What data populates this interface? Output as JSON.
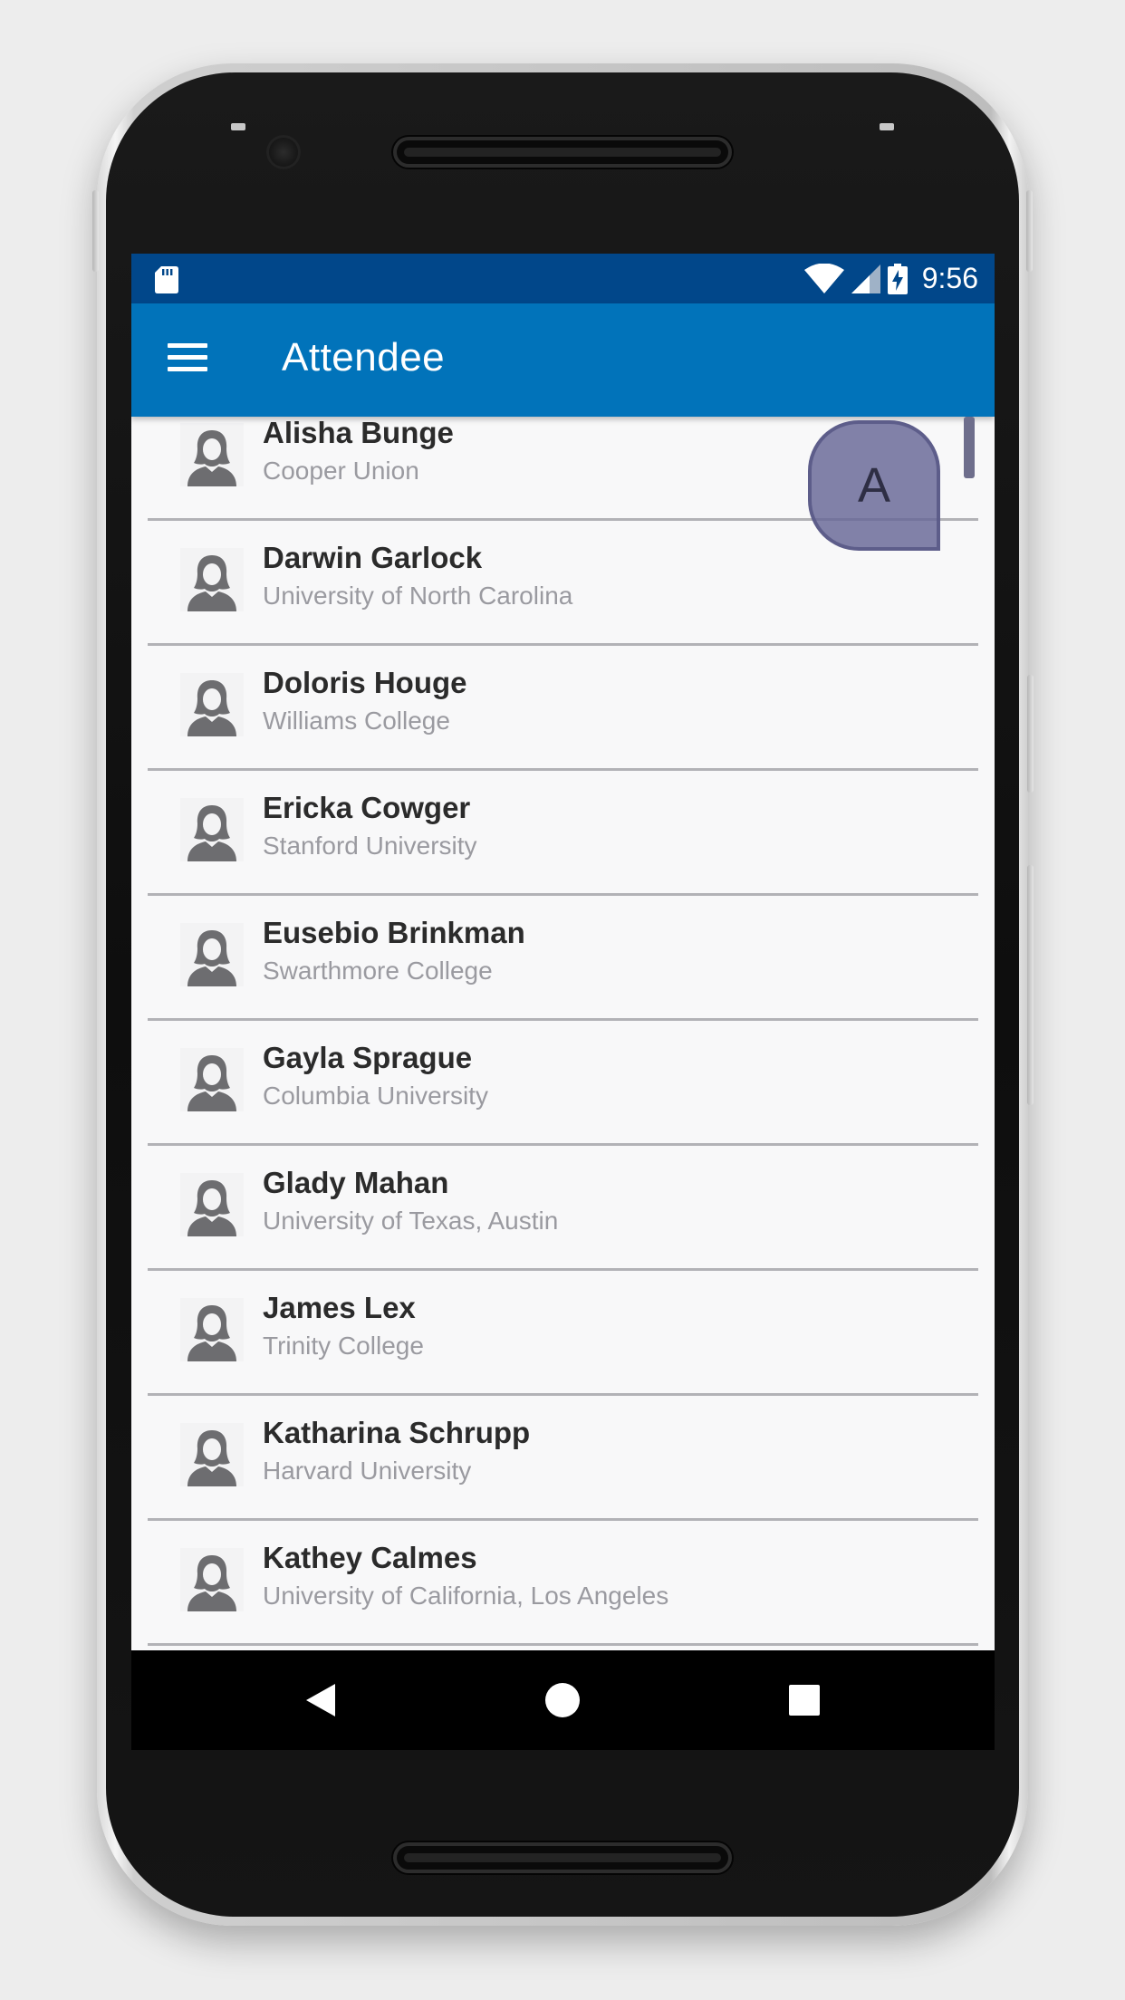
{
  "status_bar": {
    "time": "9:56",
    "icons": [
      "sd-card-icon",
      "wifi-icon",
      "cell-signal-icon",
      "battery-charging-icon"
    ],
    "background": "#01478a"
  },
  "app_bar": {
    "title": "Attendee",
    "menu_icon": "hamburger-menu-icon",
    "background": "#0173ba"
  },
  "index_popup": {
    "letter": "A"
  },
  "attendees": [
    {
      "name": "Alisha Bunge",
      "org": "Cooper Union"
    },
    {
      "name": "Darwin Garlock",
      "org": "University of North Carolina"
    },
    {
      "name": "Doloris Houge",
      "org": "Williams College"
    },
    {
      "name": "Ericka Cowger",
      "org": "Stanford University"
    },
    {
      "name": "Eusebio Brinkman",
      "org": "Swarthmore College"
    },
    {
      "name": "Gayla Sprague",
      "org": "Columbia University"
    },
    {
      "name": "Glady Mahan",
      "org": "University of Texas, Austin"
    },
    {
      "name": "James Lex",
      "org": "Trinity College"
    },
    {
      "name": "Katharina Schrupp",
      "org": "Harvard University"
    },
    {
      "name": "Kathey Calmes",
      "org": "University of California, Los Angeles"
    }
  ],
  "nav_bar": {
    "buttons": [
      "back-icon",
      "home-icon",
      "recents-icon"
    ]
  }
}
